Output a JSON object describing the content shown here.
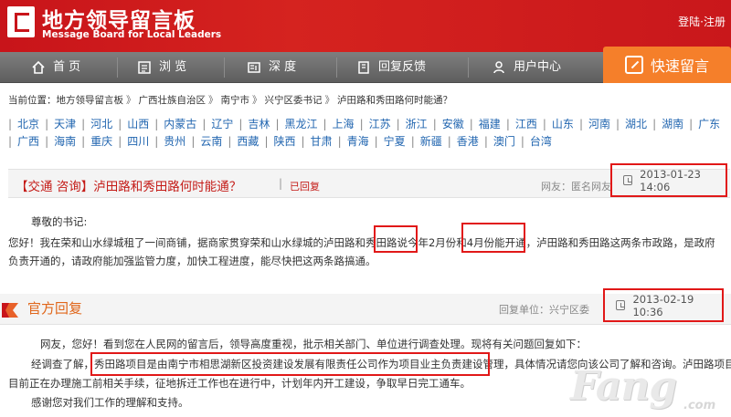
{
  "header": {
    "logo_title": "地方领导留言板",
    "logo_subtitle": "Message Board for Local Leaders",
    "login": "登陆",
    "auth_sep": "·",
    "register": "注册"
  },
  "nav": {
    "items": [
      {
        "label": "首 页",
        "icon": "home-icon"
      },
      {
        "label": "浏 览",
        "icon": "list-icon"
      },
      {
        "label": "深 度",
        "icon": "document-icon"
      },
      {
        "label": "回复反馈",
        "icon": "feedback-icon"
      },
      {
        "label": "用户中心",
        "icon": "user-icon"
      }
    ],
    "quick_message": "快速留言"
  },
  "breadcrumb": {
    "prefix": "当前位置：",
    "items": [
      "地方领导留言板",
      "广西壮族自治区",
      "南宁市",
      "兴宁区委书记",
      "泸田路和秀田路何时能通？"
    ],
    "separator": "》"
  },
  "regions": {
    "row1": [
      "北京",
      "天津",
      "河北",
      "山西",
      "内蒙古",
      "辽宁",
      "吉林",
      "黑龙江",
      "上海",
      "江苏",
      "浙江",
      "安徽",
      "福建",
      "江西",
      "山东",
      "河南",
      "湖北",
      "湖南",
      "广东"
    ],
    "row2": [
      "广西",
      "海南",
      "重庆",
      "四川",
      "贵州",
      "云南",
      "西藏",
      "陕西",
      "甘肃",
      "青海",
      "宁夏",
      "新疆",
      "香港",
      "澳门",
      "台湾"
    ],
    "divider": "|"
  },
  "message": {
    "title": "【交通 咨询】泸田路和秀田路何时能通？",
    "title_sep": "|",
    "status": "已回复",
    "author": "网友：匿名网友",
    "date": "2013-01-23 14:06",
    "greeting": "尊敬的书记:",
    "body_line1": "您好！我在荣和山水绿城租了一间商铺，据商家贯穿荣和山水绿城的泸田路和秀田路说今年2月份和4月份能开通，泸田路和秀田路这两条市政路，是政府",
    "body_line2": "负责开通的，请政府能加强监管力度，加快工程进度，能尽快把这两条路搞通。"
  },
  "reply": {
    "heading": "官方回复",
    "unit": "回复单位：兴宁区委",
    "date": "2013-02-19 10:36",
    "line1": "网友，您好！看到您在人民网的留言后，领导高度重视，批示相关部门、单位进行调查处理。现将有关问题回复如下：",
    "line2": "经调查了解，秀田路项目是由南宁市相思湖新区投资建设发展有限责任公司作为项目业主负责建设管理，具体情况请您向该公司了解和咨询。泸田路项目",
    "line3": "目前正在办理施工前相关手续，征地拆迁工作也在进行中，计划年内开工建设，争取早日完工通车。",
    "line4": "感谢您对我们工作的理解和支持。"
  },
  "watermark": {
    "brand": "Fang",
    "suffix": ".com"
  },
  "colors": {
    "brand_red": "#c8141a",
    "nav_gray": "#6e6e6e",
    "quick_orange": "#f57f2a",
    "highlight_red": "#e11818",
    "link_blue": "#2266b0"
  }
}
